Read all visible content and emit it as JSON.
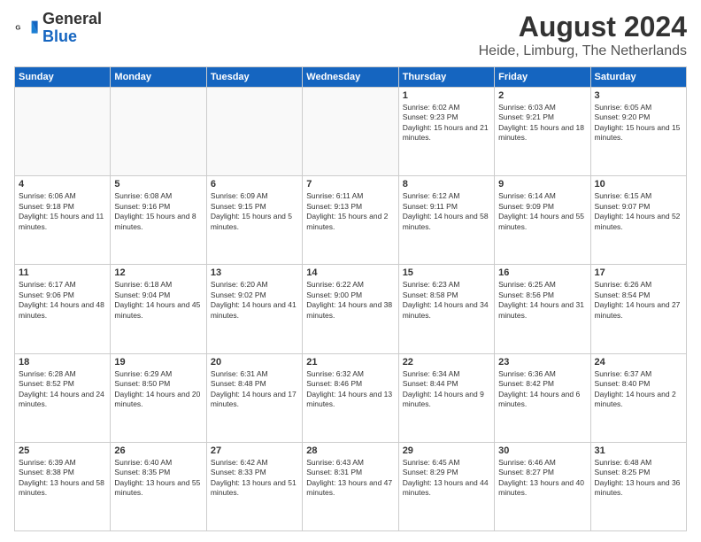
{
  "logo": {
    "general": "General",
    "blue": "Blue"
  },
  "header": {
    "title": "August 2024",
    "subtitle": "Heide, Limburg, The Netherlands"
  },
  "days_of_week": [
    "Sunday",
    "Monday",
    "Tuesday",
    "Wednesday",
    "Thursday",
    "Friday",
    "Saturday"
  ],
  "weeks": [
    [
      {
        "day": "",
        "info": ""
      },
      {
        "day": "",
        "info": ""
      },
      {
        "day": "",
        "info": ""
      },
      {
        "day": "",
        "info": ""
      },
      {
        "day": "1",
        "info": "Sunrise: 6:02 AM\nSunset: 9:23 PM\nDaylight: 15 hours and 21 minutes."
      },
      {
        "day": "2",
        "info": "Sunrise: 6:03 AM\nSunset: 9:21 PM\nDaylight: 15 hours and 18 minutes."
      },
      {
        "day": "3",
        "info": "Sunrise: 6:05 AM\nSunset: 9:20 PM\nDaylight: 15 hours and 15 minutes."
      }
    ],
    [
      {
        "day": "4",
        "info": "Sunrise: 6:06 AM\nSunset: 9:18 PM\nDaylight: 15 hours and 11 minutes."
      },
      {
        "day": "5",
        "info": "Sunrise: 6:08 AM\nSunset: 9:16 PM\nDaylight: 15 hours and 8 minutes."
      },
      {
        "day": "6",
        "info": "Sunrise: 6:09 AM\nSunset: 9:15 PM\nDaylight: 15 hours and 5 minutes."
      },
      {
        "day": "7",
        "info": "Sunrise: 6:11 AM\nSunset: 9:13 PM\nDaylight: 15 hours and 2 minutes."
      },
      {
        "day": "8",
        "info": "Sunrise: 6:12 AM\nSunset: 9:11 PM\nDaylight: 14 hours and 58 minutes."
      },
      {
        "day": "9",
        "info": "Sunrise: 6:14 AM\nSunset: 9:09 PM\nDaylight: 14 hours and 55 minutes."
      },
      {
        "day": "10",
        "info": "Sunrise: 6:15 AM\nSunset: 9:07 PM\nDaylight: 14 hours and 52 minutes."
      }
    ],
    [
      {
        "day": "11",
        "info": "Sunrise: 6:17 AM\nSunset: 9:06 PM\nDaylight: 14 hours and 48 minutes."
      },
      {
        "day": "12",
        "info": "Sunrise: 6:18 AM\nSunset: 9:04 PM\nDaylight: 14 hours and 45 minutes."
      },
      {
        "day": "13",
        "info": "Sunrise: 6:20 AM\nSunset: 9:02 PM\nDaylight: 14 hours and 41 minutes."
      },
      {
        "day": "14",
        "info": "Sunrise: 6:22 AM\nSunset: 9:00 PM\nDaylight: 14 hours and 38 minutes."
      },
      {
        "day": "15",
        "info": "Sunrise: 6:23 AM\nSunset: 8:58 PM\nDaylight: 14 hours and 34 minutes."
      },
      {
        "day": "16",
        "info": "Sunrise: 6:25 AM\nSunset: 8:56 PM\nDaylight: 14 hours and 31 minutes."
      },
      {
        "day": "17",
        "info": "Sunrise: 6:26 AM\nSunset: 8:54 PM\nDaylight: 14 hours and 27 minutes."
      }
    ],
    [
      {
        "day": "18",
        "info": "Sunrise: 6:28 AM\nSunset: 8:52 PM\nDaylight: 14 hours and 24 minutes."
      },
      {
        "day": "19",
        "info": "Sunrise: 6:29 AM\nSunset: 8:50 PM\nDaylight: 14 hours and 20 minutes."
      },
      {
        "day": "20",
        "info": "Sunrise: 6:31 AM\nSunset: 8:48 PM\nDaylight: 14 hours and 17 minutes."
      },
      {
        "day": "21",
        "info": "Sunrise: 6:32 AM\nSunset: 8:46 PM\nDaylight: 14 hours and 13 minutes."
      },
      {
        "day": "22",
        "info": "Sunrise: 6:34 AM\nSunset: 8:44 PM\nDaylight: 14 hours and 9 minutes."
      },
      {
        "day": "23",
        "info": "Sunrise: 6:36 AM\nSunset: 8:42 PM\nDaylight: 14 hours and 6 minutes."
      },
      {
        "day": "24",
        "info": "Sunrise: 6:37 AM\nSunset: 8:40 PM\nDaylight: 14 hours and 2 minutes."
      }
    ],
    [
      {
        "day": "25",
        "info": "Sunrise: 6:39 AM\nSunset: 8:38 PM\nDaylight: 13 hours and 58 minutes."
      },
      {
        "day": "26",
        "info": "Sunrise: 6:40 AM\nSunset: 8:35 PM\nDaylight: 13 hours and 55 minutes."
      },
      {
        "day": "27",
        "info": "Sunrise: 6:42 AM\nSunset: 8:33 PM\nDaylight: 13 hours and 51 minutes."
      },
      {
        "day": "28",
        "info": "Sunrise: 6:43 AM\nSunset: 8:31 PM\nDaylight: 13 hours and 47 minutes."
      },
      {
        "day": "29",
        "info": "Sunrise: 6:45 AM\nSunset: 8:29 PM\nDaylight: 13 hours and 44 minutes."
      },
      {
        "day": "30",
        "info": "Sunrise: 6:46 AM\nSunset: 8:27 PM\nDaylight: 13 hours and 40 minutes."
      },
      {
        "day": "31",
        "info": "Sunrise: 6:48 AM\nSunset: 8:25 PM\nDaylight: 13 hours and 36 minutes."
      }
    ]
  ]
}
